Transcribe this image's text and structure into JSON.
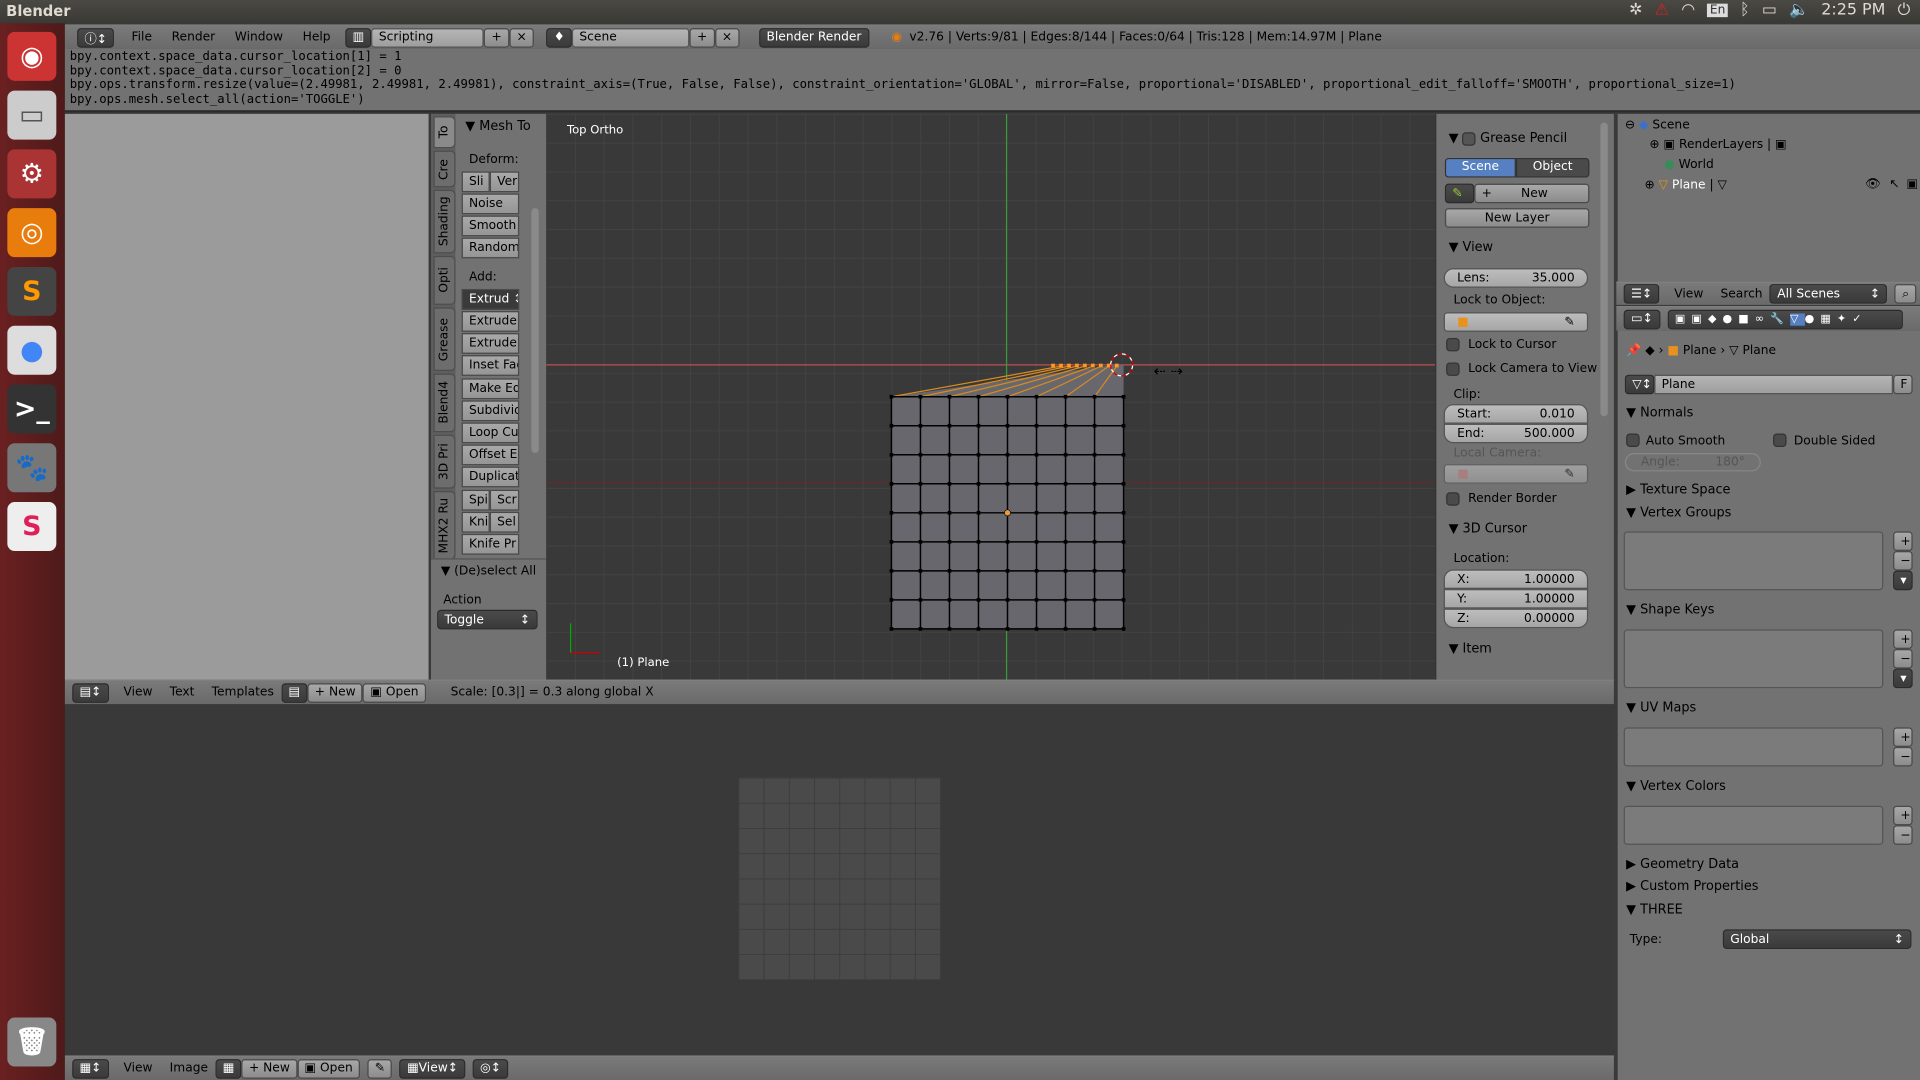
{
  "system": {
    "app_title": "Blender",
    "time": "2:25 PM",
    "keyboard": "En"
  },
  "info_header": {
    "menus": [
      "File",
      "Render",
      "Window",
      "Help"
    ],
    "layout": "Scripting",
    "scene": "Scene",
    "engine": "Blender Render",
    "stats": "v2.76 | Verts:9/81 | Edges:8/144 | Faces:0/64 | Tris:128 | Mem:14.97M | Plane"
  },
  "console_lines": [
    "bpy.context.space_data.cursor_location[1] = 1",
    "bpy.context.space_data.cursor_location[2] = 0",
    "bpy.ops.transform.resize(value=(2.49981, 2.49981, 2.49981), constraint_axis=(True, False, False), constraint_orientation='GLOBAL', mirror=False, proportional='DISABLED', proportional_edit_falloff='SMOOTH', proportional_size=1)",
    "bpy.ops.mesh.select_all(action='TOGGLE')"
  ],
  "tool_tabs": [
    "To",
    "Cre",
    "Shading",
    "Opti",
    "Grease",
    "Blend4",
    "3D Pri",
    "MHX2 Ru"
  ],
  "tool_shelf": {
    "title": "Mesh To",
    "deform_label": "Deform:",
    "deform": [
      "Sli",
      "Ver",
      "Noise",
      "Smooth",
      "Random"
    ],
    "add_label": "Add:",
    "add_select": "Extrud",
    "add": [
      "Extrude",
      "Extrude",
      "Inset Fac",
      "Make Ed",
      "Subdivid",
      "Loop Cu",
      "Offset E",
      "Duplicat",
      "Spi",
      "Scr",
      "Kni",
      "Sel",
      "Knife Pr"
    ],
    "operator_title": "(De)select All",
    "action_label": "Action",
    "action_value": "Toggle"
  },
  "viewport": {
    "view_name": "Top Ortho",
    "object_label": "(1) Plane",
    "status": "Scale: [0.3|] = 0.3 along global X",
    "axis_x_color": "#c05050",
    "axis_y_color": "#3a9a3a"
  },
  "n_panel": {
    "grease_title": "Grease Pencil",
    "scene_tab": "Scene",
    "object_tab": "Object",
    "new": "New",
    "new_layer": "New Layer",
    "view_title": "View",
    "lens_label": "Lens:",
    "lens": "35.000",
    "lock_object": "Lock to Object:",
    "lock_cursor": "Lock to Cursor",
    "lock_camera": "Lock Camera to View",
    "clip": "Clip:",
    "start_label": "Start:",
    "start": "0.010",
    "end_label": "End:",
    "end": "500.000",
    "local_camera": "Local Camera:",
    "render_border": "Render Border",
    "cursor_title": "3D Cursor",
    "location": "Location:",
    "x_label": "X:",
    "x": "1.00000",
    "y_label": "Y:",
    "y": "1.00000",
    "z_label": "Z:",
    "z": "0.00000",
    "item_title": "Item"
  },
  "text_header": {
    "menus": [
      "View",
      "Text",
      "Templates"
    ],
    "new": "New",
    "open": "Open"
  },
  "outliner": {
    "items": [
      "Scene",
      "RenderLayers",
      "World",
      "Plane"
    ],
    "view": "View",
    "search": "Search",
    "filter": "All Scenes"
  },
  "properties": {
    "breadcrumb": [
      "Plane",
      "Plane"
    ],
    "mesh_name": "Plane",
    "fake_user": "F",
    "normals": "Normals",
    "auto_smooth": "Auto Smooth",
    "double_sided": "Double Sided",
    "angle_label": "Angle:",
    "angle": "180°",
    "texture_space": "Texture Space",
    "vertex_groups": "Vertex Groups",
    "shape_keys": "Shape Keys",
    "uv_maps": "UV Maps",
    "vertex_colors": "Vertex Colors",
    "geometry_data": "Geometry Data",
    "custom_properties": "Custom Properties",
    "three": "THREE",
    "type_label": "Type:",
    "type_value": "Global"
  },
  "image_header": {
    "menus": [
      "View",
      "Image"
    ],
    "new": "New",
    "open": "Open",
    "view_select": "View"
  }
}
